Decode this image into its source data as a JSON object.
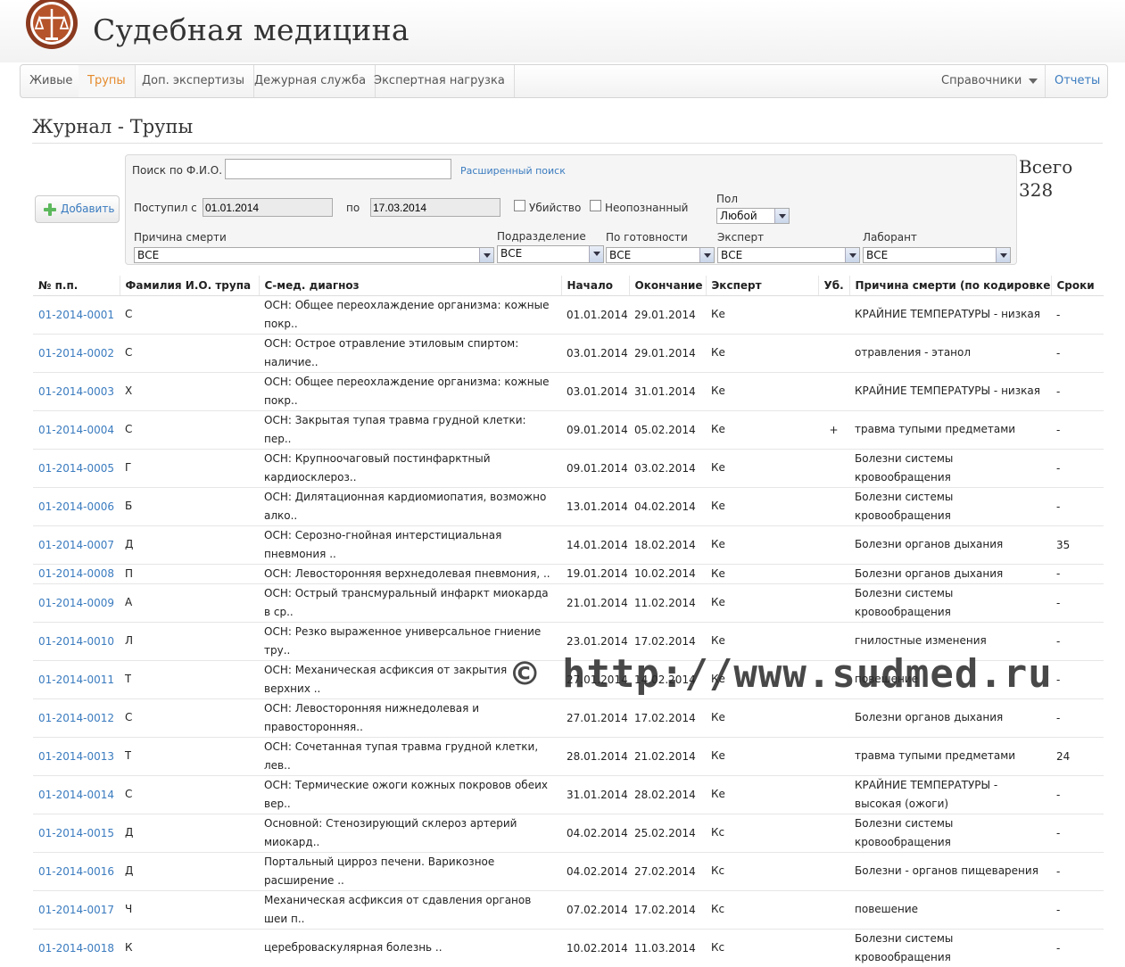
{
  "header": {
    "brand": "Судебная медицина",
    "logo_icon": "forensic-scales-logo"
  },
  "nav": {
    "items": [
      {
        "label": "Живые",
        "active": false
      },
      {
        "label": "Трупы",
        "active": true
      },
      {
        "label": "Доп. экспертизы",
        "active": false
      },
      {
        "label": "Дежурная служба",
        "active": false
      },
      {
        "label": "Экспертная нагрузка",
        "active": false
      }
    ],
    "right": {
      "references_label": "Справочники",
      "reports_label": "Отчеты"
    }
  },
  "page": {
    "title": "Журнал - Трупы",
    "add_button": "Добавить"
  },
  "filters": {
    "search_label": "Поиск по Ф.И.О.",
    "search_value": "",
    "advanced_link": "Расширенный поиск",
    "received_from_label": "Поступил с",
    "date_from": "01.01.2014",
    "to_label": "по",
    "date_to": "17.03.2014",
    "murder_label": "Убийство",
    "unidentified_label": "Неопознанный",
    "sex_label": "Пол",
    "sex_value": "Любой",
    "cause_label": "Причина смерти",
    "cause_value": "ВСЕ",
    "division_label": "Подразделение",
    "division_value": "ВСЕ",
    "readiness_label": "По готовности",
    "readiness_value": "ВСЕ",
    "expert_label": "Эксперт",
    "expert_value": "ВСЕ",
    "lab_label": "Лаборант",
    "lab_value": "ВСЕ"
  },
  "total": {
    "label": "Всего",
    "count": "328"
  },
  "table": {
    "columns": [
      "№ п.п.",
      "Фамилия И.О. трупа",
      "С-мед. диагноз",
      "Начало",
      "Окончание",
      "Эксперт",
      "Уб.",
      "Причина смерти (по кодировке)",
      "Сроки"
    ],
    "rows": [
      {
        "num": "01-2014-0001",
        "name": "С",
        "diag": "ОСН: Общее переохлаждение организма: кожные покр..",
        "start": "01.01.2014",
        "end": "29.01.2014",
        "expert": "Ке",
        "murder": "",
        "cause": "КРАЙНИЕ ТЕМПЕРАТУРЫ - низкая",
        "term": "-"
      },
      {
        "num": "01-2014-0002",
        "name": "С",
        "diag": "ОСН: Острое отравление этиловым спиртом: наличие..",
        "start": "03.01.2014",
        "end": "29.01.2014",
        "expert": "Ке",
        "murder": "",
        "cause": "отравления - этанол",
        "term": "-"
      },
      {
        "num": "01-2014-0003",
        "name": "Х",
        "diag": "ОСН: Общее переохлаждение организма: кожные покр..",
        "start": "03.01.2014",
        "end": "31.01.2014",
        "expert": "Ке",
        "murder": "",
        "cause": "КРАЙНИЕ ТЕМПЕРАТУРЫ - низкая",
        "term": "-"
      },
      {
        "num": "01-2014-0004",
        "name": "С",
        "diag": "ОСН: Закрытая тупая травма грудной клетки: пер..",
        "start": "09.01.2014",
        "end": "05.02.2014",
        "expert": "Ке",
        "murder": "+",
        "cause": "травма тупыми предметами",
        "term": "-"
      },
      {
        "num": "01-2014-0005",
        "name": "Г",
        "diag": "ОСН: Крупноочаговый постинфарктный кардиосклероз..",
        "start": "09.01.2014",
        "end": "03.02.2014",
        "expert": "Ке",
        "murder": "",
        "cause": "Болезни системы кровообращения",
        "term": "-"
      },
      {
        "num": "01-2014-0006",
        "name": "Б",
        "diag": "ОСН: Дилятационная кардиомиопатия, возможно алко..",
        "start": "13.01.2014",
        "end": "04.02.2014",
        "expert": "Ке",
        "murder": "",
        "cause": "Болезни системы кровообращения",
        "term": "-"
      },
      {
        "num": "01-2014-0007",
        "name": "Д",
        "diag": "ОСН: Серозно-гнойная интерстициальная пневмония ..",
        "start": "14.01.2014",
        "end": "18.02.2014",
        "expert": "Ке",
        "murder": "",
        "cause": "Болезни органов дыхания",
        "term": "35"
      },
      {
        "num": "01-2014-0008",
        "name": "П",
        "diag": "ОСН: Левосторонняя верхнедолевая пневмония, ..",
        "start": "19.01.2014",
        "end": "10.02.2014",
        "expert": "Ке",
        "murder": "",
        "cause": "Болезни органов дыхания",
        "term": "-"
      },
      {
        "num": "01-2014-0009",
        "name": "А",
        "diag": "ОСН: Острый трансмуральный инфаркт миокарда в ср..",
        "start": "21.01.2014",
        "end": "11.02.2014",
        "expert": "Ке",
        "murder": "",
        "cause": "Болезни системы кровообращения",
        "term": "-"
      },
      {
        "num": "01-2014-0010",
        "name": "Л",
        "diag": "ОСН: Резко выраженное универсальное гниение тру..",
        "start": "23.01.2014",
        "end": "17.02.2014",
        "expert": "Ке",
        "murder": "",
        "cause": "гнилостные изменения",
        "term": "-"
      },
      {
        "num": "01-2014-0011",
        "name": "Т",
        "diag": "ОСН: Механическая асфиксия от закрытия верхних ..",
        "start": "27.01.2014",
        "end": "14.02.2014",
        "expert": "Ке",
        "murder": "",
        "cause": "повешение",
        "term": "-"
      },
      {
        "num": "01-2014-0012",
        "name": "С",
        "diag": "ОСН: Левосторонняя нижнедолевая и правосторонняя..",
        "start": "27.01.2014",
        "end": "17.02.2014",
        "expert": "Ке",
        "murder": "",
        "cause": "Болезни органов дыхания",
        "term": "-"
      },
      {
        "num": "01-2014-0013",
        "name": "Т",
        "diag": "ОСН: Сочетанная тупая травма грудной клетки, лев..",
        "start": "28.01.2014",
        "end": "21.02.2014",
        "expert": "Ке",
        "murder": "",
        "cause": "травма тупыми предметами",
        "term": "24"
      },
      {
        "num": "01-2014-0014",
        "name": "С",
        "diag": "ОСН: Термические ожоги кожных покровов обеих вер..",
        "start": "31.01.2014",
        "end": "28.02.2014",
        "expert": "Ке",
        "murder": "",
        "cause": "КРАЙНИЕ ТЕМПЕРАТУРЫ - высокая (ожоги)",
        "term": "-"
      },
      {
        "num": "01-2014-0015",
        "name": "Д",
        "diag": "Основной: Стенозирующий склероз артерий миокард..",
        "start": "04.02.2014",
        "end": "25.02.2014",
        "expert": "Кс",
        "murder": "",
        "cause": "Болезни системы кровообращения",
        "term": "-"
      },
      {
        "num": "01-2014-0016",
        "name": "Д",
        "diag": "Портальный цирроз печени. Варикозное расширение ..",
        "start": "04.02.2014",
        "end": "27.02.2014",
        "expert": "Кс",
        "murder": "",
        "cause": "Болезни - органов пищеварения",
        "term": "-"
      },
      {
        "num": "01-2014-0017",
        "name": "Ч",
        "diag": "Механическая асфиксия от сдавления органов шеи п..",
        "start": "07.02.2014",
        "end": "17.02.2014",
        "expert": "Кс",
        "murder": "",
        "cause": "повешение",
        "term": "-"
      },
      {
        "num": "01-2014-0018",
        "name": "К",
        "diag": "цереброваскулярная болезнь ..",
        "start": "10.02.2014",
        "end": "11.03.2014",
        "expert": "Кс",
        "murder": "",
        "cause": "Болезни системы кровообращения",
        "term": "-"
      }
    ]
  },
  "watermark": "© http://www.sudmed.ru"
}
